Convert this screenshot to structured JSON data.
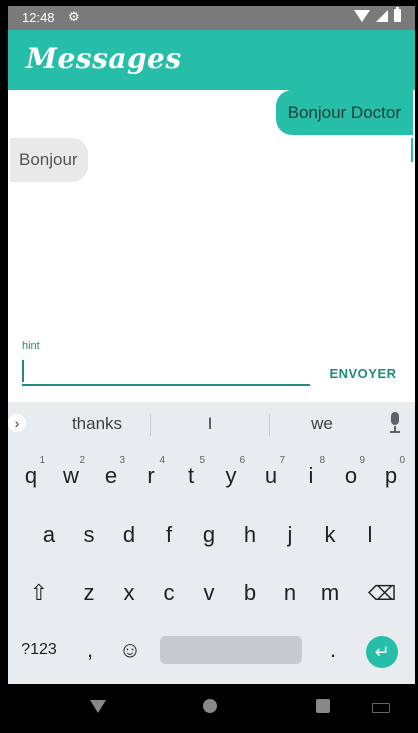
{
  "status_bar": {
    "time": "12:48"
  },
  "app_bar": {
    "title": "Messages"
  },
  "messages": [
    {
      "direction": "outgoing",
      "text": "Bonjour Doctor"
    },
    {
      "direction": "incoming",
      "text": "Bonjour"
    }
  ],
  "composer": {
    "hint_label": "hint",
    "input_value": "",
    "send_label": "ENVOYER"
  },
  "keyboard": {
    "suggestions": [
      "thanks",
      "I",
      "we"
    ],
    "row1": [
      {
        "key": "q",
        "alt": "1"
      },
      {
        "key": "w",
        "alt": "2"
      },
      {
        "key": "e",
        "alt": "3"
      },
      {
        "key": "r",
        "alt": "4"
      },
      {
        "key": "t",
        "alt": "5"
      },
      {
        "key": "y",
        "alt": "6"
      },
      {
        "key": "u",
        "alt": "7"
      },
      {
        "key": "i",
        "alt": "8"
      },
      {
        "key": "o",
        "alt": "9"
      },
      {
        "key": "p",
        "alt": "0"
      }
    ],
    "row2": [
      "a",
      "s",
      "d",
      "f",
      "g",
      "h",
      "j",
      "k",
      "l"
    ],
    "row3": [
      "z",
      "x",
      "c",
      "v",
      "b",
      "n",
      "m"
    ],
    "symbols_label": "?123",
    "comma": ",",
    "period": "."
  },
  "colors": {
    "accent": "#26bea8",
    "accent_dark": "#1f8c7f",
    "status_bar": "#7a7a7a",
    "incoming_bubble": "#e9e9e9",
    "keyboard_bg": "#e8ecef"
  }
}
